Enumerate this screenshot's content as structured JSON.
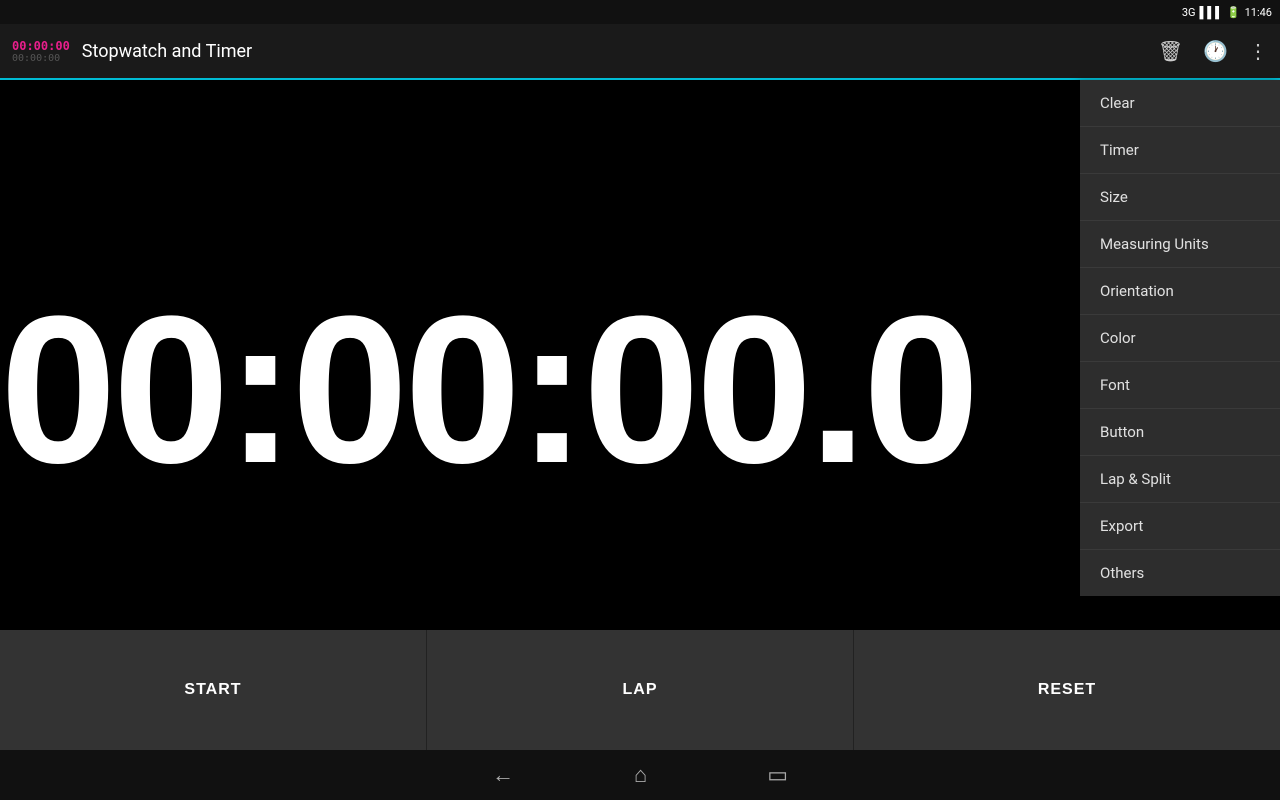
{
  "statusBar": {
    "network": "3G",
    "battery": "🔋",
    "time": "11:46"
  },
  "appBar": {
    "title": "Stopwatch and Timer",
    "timerPrimary": "00:00:00",
    "timerSecondary": "00:00:00",
    "icons": {
      "trash": "🗑",
      "history": "🕐",
      "more": "⋮"
    }
  },
  "stopwatch": {
    "display": "00:00:00.0"
  },
  "buttons": {
    "start": "START",
    "lap": "LAP",
    "reset": "RESET"
  },
  "menu": {
    "items": [
      {
        "label": "Clear",
        "id": "clear"
      },
      {
        "label": "Timer",
        "id": "timer"
      },
      {
        "label": "Size",
        "id": "size"
      },
      {
        "label": "Measuring Units",
        "id": "measuring-units"
      },
      {
        "label": "Orientation",
        "id": "orientation"
      },
      {
        "label": "Color",
        "id": "color"
      },
      {
        "label": "Font",
        "id": "font"
      },
      {
        "label": "Button",
        "id": "button"
      },
      {
        "label": "Lap & Split",
        "id": "lap-split"
      },
      {
        "label": "Export",
        "id": "export"
      },
      {
        "label": "Others",
        "id": "others"
      }
    ]
  },
  "navBar": {
    "back": "←",
    "home": "⌂",
    "recents": "▭"
  }
}
